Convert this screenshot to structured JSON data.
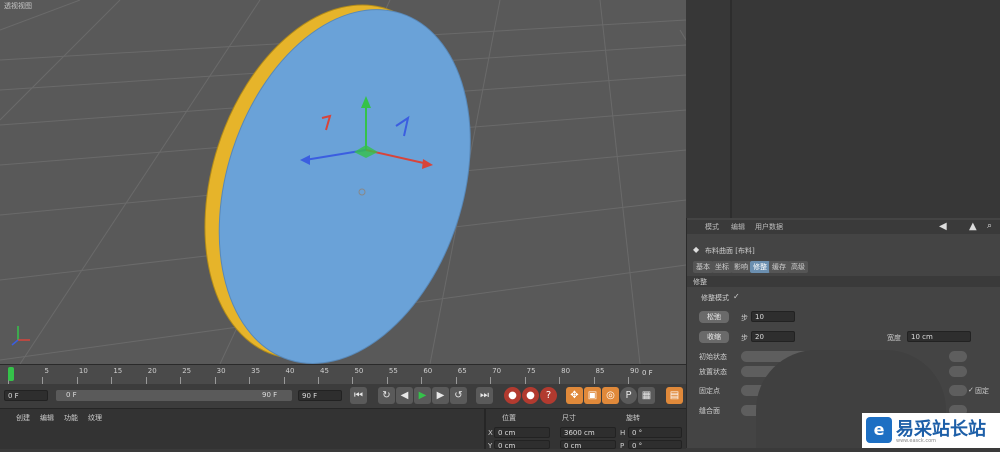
{
  "viewport": {
    "title": "透视视图"
  },
  "attributes": {
    "header_tabs": [
      "模式",
      "编辑",
      "用户数据"
    ],
    "object_title": "布料曲面 [布料]",
    "sub_tabs": [
      "基本",
      "坐标",
      "影响",
      "修整",
      "缓存",
      "高级"
    ],
    "active_sub_tab": "修整",
    "section": "修整",
    "dress_mode_label": "修整模式",
    "dress_mode_check": "✓",
    "relax_button": "松弛",
    "relax_step_label": "步",
    "relax_step_value": "10",
    "shrink_button": "收缩",
    "shrink_step_label": "步",
    "shrink_step_value": "20",
    "width_label": "宽度",
    "width_value": "10 cm",
    "init_state_label": "初始状态",
    "set_state_label": "放置状态",
    "fixed_points_label": "固定点",
    "seam_label": "缝合面",
    "lock_label": "固定",
    "lock_value": "✓"
  },
  "timeline": {
    "ticks": [
      "0",
      "5",
      "10",
      "15",
      "20",
      "25",
      "30",
      "35",
      "40",
      "45",
      "50",
      "55",
      "60",
      "65",
      "70",
      "75",
      "80",
      "85",
      "90"
    ],
    "current_frame_pct": 0,
    "end_label": "0 F"
  },
  "transport": {
    "start_frame": "0 F",
    "range_start": "0 F",
    "range_end": "90 F",
    "end_frame": "90 F"
  },
  "bottom": {
    "menus": [
      "创建",
      "编辑",
      "功能",
      "纹理"
    ],
    "coord_headers": [
      "位置",
      "尺寸",
      "旋转"
    ],
    "pos_x": "0 cm",
    "size_x": "3600 cm",
    "rot_h": "0 °",
    "pos_y": "0 cm",
    "size_y": "0 cm",
    "rot_p": "0 °",
    "axis_x": "X",
    "axis_h": "H",
    "axis_y": "Y",
    "axis_p": "P"
  },
  "watermark": {
    "text": "易采站长站",
    "url": "www.easck.com",
    "logo_glyph": "e"
  },
  "colors": {
    "disc_fill": "#6aa2d8",
    "disc_edge": "#e6b42a",
    "axis_green": "#35c24a",
    "axis_red": "#d8443a",
    "axis_blue": "#3b5ee0"
  }
}
